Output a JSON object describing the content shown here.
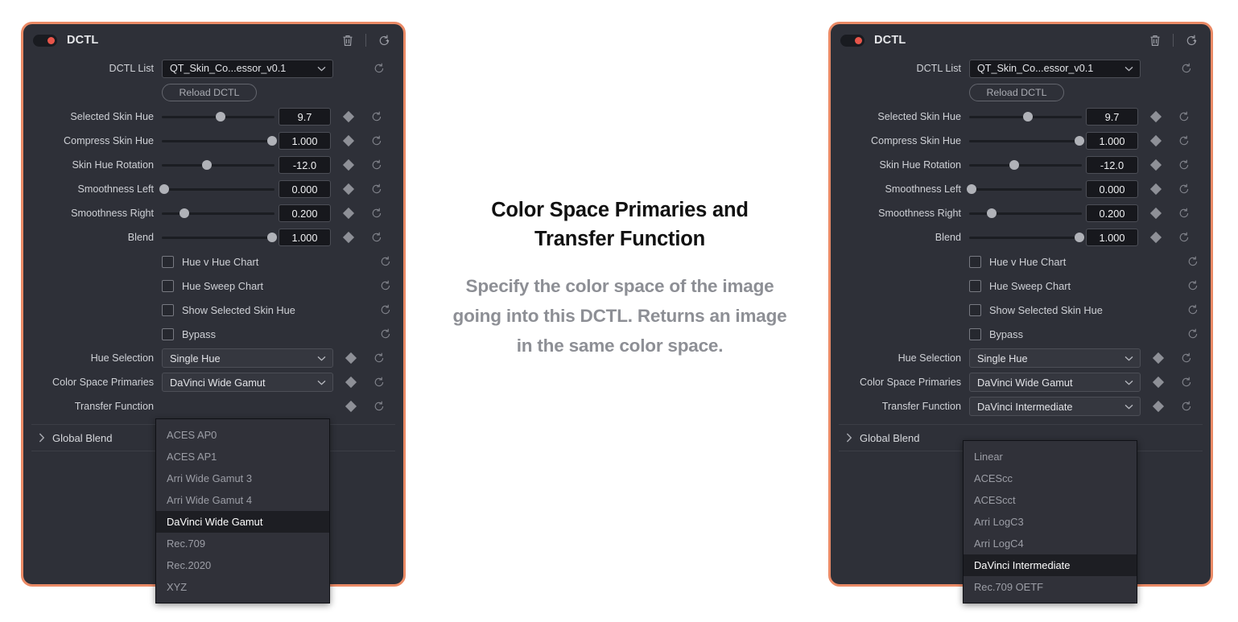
{
  "background_color": "#ffffff",
  "panel_border_color": "#ea8a66",
  "panel_bg_color": "#2e3038",
  "accent_color": "#e8554a",
  "header": {
    "title": "DCTL",
    "toggle_state": "on",
    "delete_icon": "trash-icon",
    "reset_all_icon": "reset-add-icon"
  },
  "dctl_list": {
    "label": "DCTL List",
    "value": "QT_Skin_Co...essor_v0.1",
    "chevron_icon": "chevron-down-icon",
    "reset_icon": "reset-icon"
  },
  "reload_button": {
    "label": "Reload DCTL"
  },
  "sliders": [
    {
      "label": "Selected Skin Hue",
      "value": "9.7",
      "percent": 52
    },
    {
      "label": "Compress Skin Hue",
      "value": "1.000",
      "percent": 98
    },
    {
      "label": "Skin Hue Rotation",
      "value": "-12.0",
      "percent": 40
    },
    {
      "label": "Smoothness Left",
      "value": "0.000",
      "percent": 2
    },
    {
      "label": "Smoothness Right",
      "value": "0.200",
      "percent": 20
    },
    {
      "label": "Blend",
      "value": "1.000",
      "percent": 98
    }
  ],
  "checkboxes": [
    {
      "label": "Hue v Hue Chart",
      "checked": false
    },
    {
      "label": "Hue Sweep Chart",
      "checked": false
    },
    {
      "label": "Show Selected Skin Hue",
      "checked": false
    },
    {
      "label": "Bypass",
      "checked": false
    }
  ],
  "selects": {
    "hue_selection": {
      "label": "Hue Selection",
      "value": "Single Hue"
    },
    "color_space_primaries": {
      "label": "Color Space Primaries",
      "value": "DaVinci Wide Gamut"
    },
    "transfer_function_left": {
      "label": "Transfer Function",
      "value": ""
    },
    "transfer_function_right": {
      "label": "Transfer Function",
      "value": "DaVinci Intermediate"
    }
  },
  "dropdown_primaries": {
    "options": [
      "ACES AP0",
      "ACES AP1",
      "Arri Wide Gamut 3",
      "Arri Wide Gamut 4",
      "DaVinci Wide Gamut",
      "Rec.709",
      "Rec.2020",
      "XYZ"
    ],
    "selected": "DaVinci Wide Gamut"
  },
  "dropdown_transfer": {
    "options": [
      "Linear",
      "ACEScc",
      "ACEScct",
      "Arri LogC3",
      "Arri LogC4",
      "DaVinci Intermediate",
      "Rec.709 OETF"
    ],
    "selected": "DaVinci Intermediate"
  },
  "global_blend": {
    "label": "Global Blend",
    "chevron_icon": "chevron-right-icon",
    "expanded": false
  },
  "caption": {
    "title": "Color Space Primaries and Transfer Function",
    "body": "Specify the color space of the image going into this DCTL. Returns an image in the same color space."
  }
}
